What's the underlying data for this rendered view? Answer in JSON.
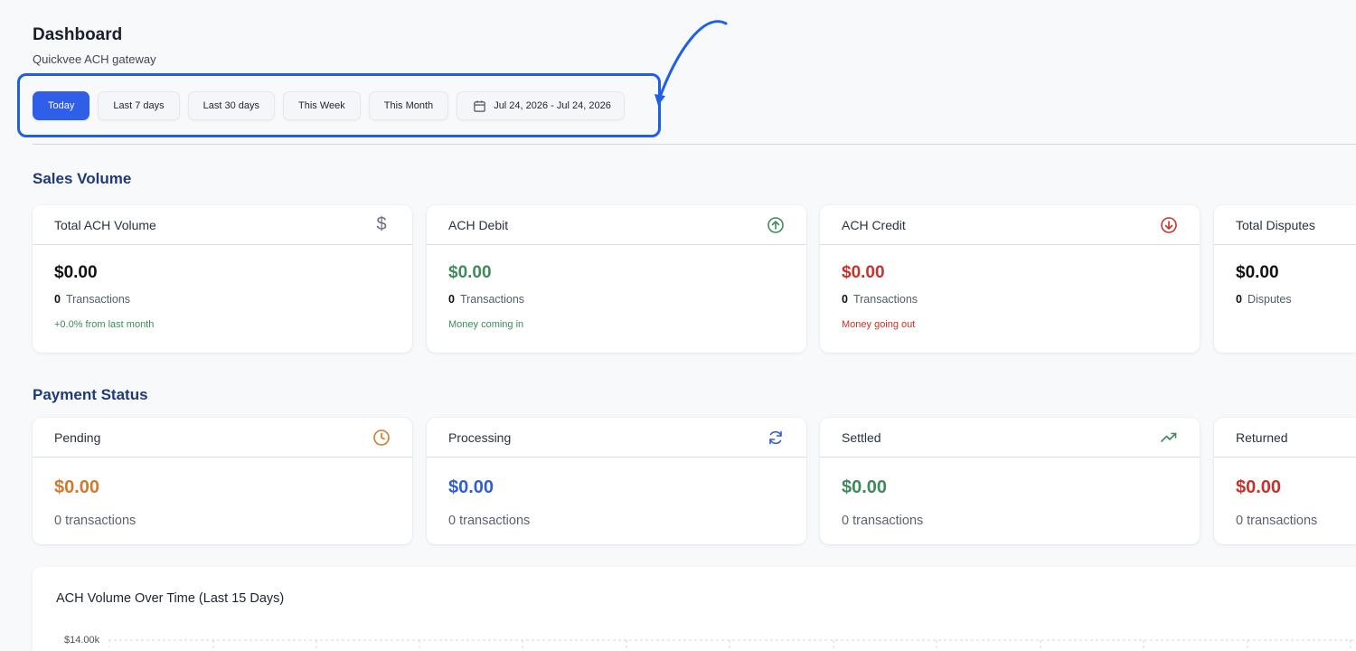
{
  "header": {
    "title": "Dashboard",
    "subtitle": "Quickvee ACH gateway"
  },
  "filters": {
    "today": "Today",
    "last7": "Last 7 days",
    "last30": "Last 30 days",
    "week": "This Week",
    "month": "This Month",
    "date_range": "Jul 24, 2026 - Jul 24, 2026",
    "active": "Today"
  },
  "sales_volume": {
    "title": "Sales Volume",
    "cards": [
      {
        "label": "Total ACH Volume",
        "amount": "$0.00",
        "count": "0",
        "count_label": "Transactions",
        "note": "+0.0% from last month",
        "icon": "dollar-icon"
      },
      {
        "label": "ACH Debit",
        "amount": "$0.00",
        "count": "0",
        "count_label": "Transactions",
        "note": "Money coming in",
        "icon": "arrow-up-circle-icon"
      },
      {
        "label": "ACH Credit",
        "amount": "$0.00",
        "count": "0",
        "count_label": "Transactions",
        "note": "Money going out",
        "icon": "arrow-down-circle-icon"
      },
      {
        "label": "Total Disputes",
        "amount": "$0.00",
        "count": "0",
        "count_label": "Disputes"
      }
    ]
  },
  "payment_status": {
    "title": "Payment Status",
    "cards": [
      {
        "label": "Pending",
        "amount": "$0.00",
        "tx": "0 transactions",
        "icon": "clock-icon"
      },
      {
        "label": "Processing",
        "amount": "$0.00",
        "tx": "0 transactions",
        "icon": "refresh-icon"
      },
      {
        "label": "Settled",
        "amount": "$0.00",
        "tx": "0 transactions",
        "icon": "trending-up-icon"
      },
      {
        "label": "Returned",
        "amount": "$0.00",
        "tx": "0 transactions"
      }
    ]
  },
  "chart": {
    "title": "ACH Volume Over Time (Last 15 Days)",
    "y_tick_top": "$14.00k"
  },
  "colors": {
    "primary": "#2f5fe9",
    "annotation": "#1f5fe8",
    "green": "#3d8a5a",
    "red": "#c8322a",
    "orange": "#d27a2c",
    "blue": "#2f5fd6",
    "section_title": "#1f3a78"
  }
}
